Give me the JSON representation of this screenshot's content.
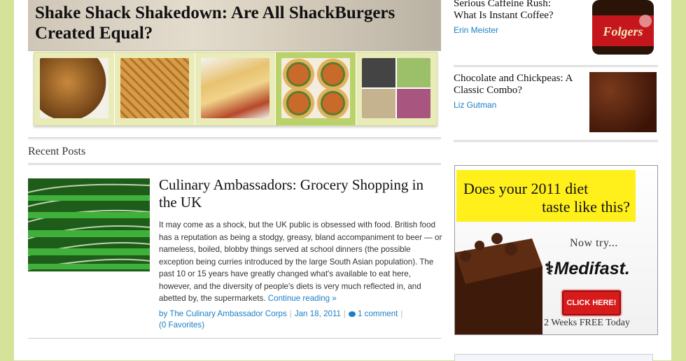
{
  "hero": {
    "title": "Shake Shack Shakedown: Are All ShackBurgers Created Equal?",
    "thumbnails": [
      {
        "name": "thumb-fries-bowl",
        "color": "#8a5a22"
      },
      {
        "name": "thumb-waffle",
        "color": "#c98b3f"
      },
      {
        "name": "thumb-fries-hotdog",
        "color": "#d9a24a"
      },
      {
        "name": "thumb-burgers-grid",
        "color": "#b55b2a"
      },
      {
        "name": "thumb-collage",
        "color": "#7f8f6a"
      }
    ],
    "active_thumbnail": 3
  },
  "recent": {
    "label": "Recent Posts"
  },
  "post": {
    "title": "Culinary Ambassadors: Grocery Shopping in the UK",
    "excerpt": "It may come as a shock, but the UK public is obsessed with food. British food has a reputation as being a stodgy, greasy, bland accompaniment to beer — or nameless, boiled, blobby things served at school dinners (the possible exception being curries introduced by the large South Asian population). The past 10 or 15 years have greatly changed what's available to eat here, however, and the diversity of people's diets is very much reflected in, and abetted by, the supermarkets.",
    "continue": "Continue reading »",
    "author": "by The Culinary Ambassador Corps",
    "date": "Jan 18, 2011",
    "comments": "1 comment",
    "favorites": "(0 Favorites)"
  },
  "sidebar": {
    "items": [
      {
        "title": "Serious Caffeine Rush: What Is Instant Coffee?",
        "author": "Erin Meister",
        "image_label": "Folgers"
      },
      {
        "title": "Chocolate and Chickpeas: A Classic Combo?",
        "author": "Liz Gutman"
      }
    ]
  },
  "ad": {
    "line1": "Does your 2011 diet",
    "line2": "taste like this?",
    "now_try": "Now try...",
    "brand": "Medifast.",
    "button": "CLICK HERE!",
    "offer": "2 Weeks FREE Today",
    "banner_color": "#ffef1b",
    "button_color": "#d71b1b"
  },
  "colors": {
    "link": "#1a7fc4",
    "background": "#d4e29a"
  }
}
